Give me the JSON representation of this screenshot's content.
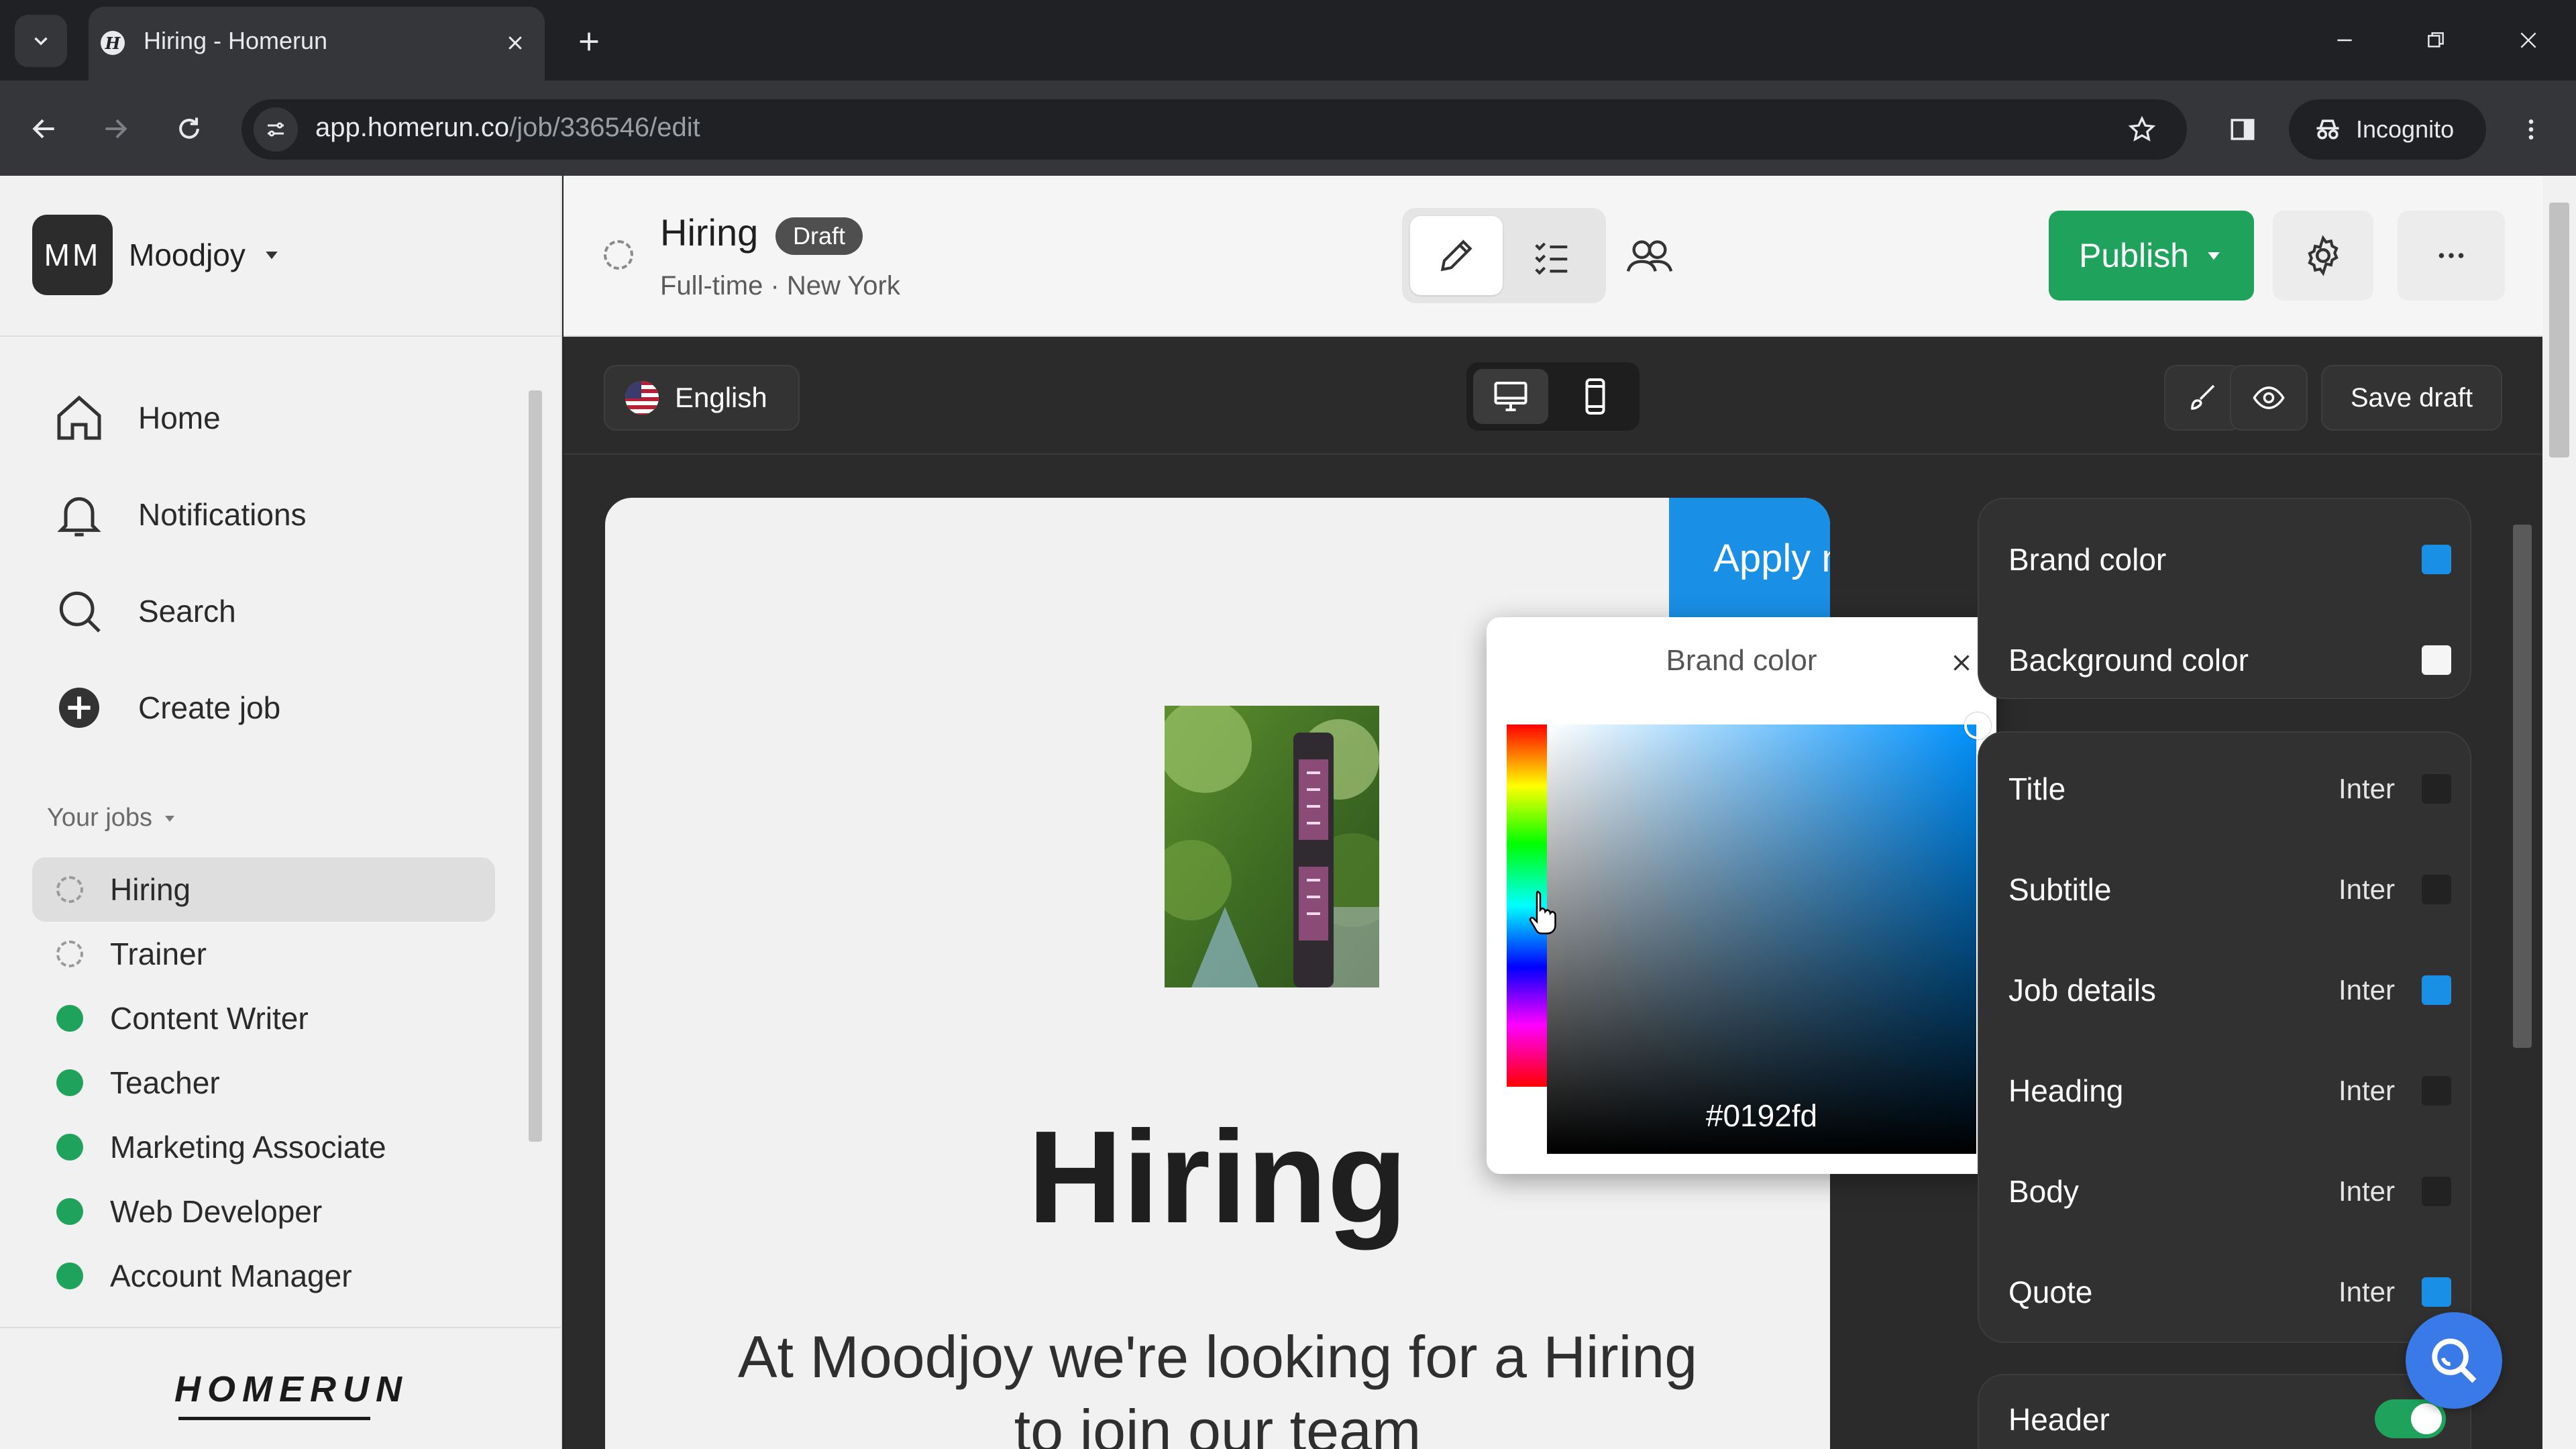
{
  "browser": {
    "tab_title": "Hiring - Homerun",
    "favicon_letter": "H",
    "url_domain": "app.homerun.co",
    "url_path": "/job/336546/edit",
    "incognito_label": "Incognito"
  },
  "sidebar": {
    "org_initials": "MM",
    "org_name": "Moodjoy",
    "nav": [
      {
        "label": "Home",
        "icon": "home-icon"
      },
      {
        "label": "Notifications",
        "icon": "bell-icon"
      },
      {
        "label": "Search",
        "icon": "search-icon"
      },
      {
        "label": "Create job",
        "icon": "plus-circle-icon"
      }
    ],
    "your_jobs_label": "Your jobs",
    "jobs": [
      {
        "label": "Hiring",
        "status": "draft"
      },
      {
        "label": "Trainer",
        "status": "draft"
      },
      {
        "label": "Content Writer",
        "status": "published"
      },
      {
        "label": "Teacher",
        "status": "published"
      },
      {
        "label": "Marketing Associate",
        "status": "published"
      },
      {
        "label": "Web Developer",
        "status": "published"
      },
      {
        "label": "Account Manager",
        "status": "published"
      }
    ],
    "logo_text": "HOMERUN"
  },
  "header": {
    "title": "Hiring",
    "badge": "Draft",
    "meta": "Full-time · New York",
    "publish_label": "Publish"
  },
  "editor": {
    "language": "English",
    "save_draft_label": "Save draft"
  },
  "preview": {
    "apply_label": "Apply now",
    "title": "Hiring",
    "subtitle_line1": "At Moodjoy we're looking for a Hiring",
    "subtitle_line2": "to join our team"
  },
  "color_picker": {
    "title": "Brand color",
    "hex": "#0192fd"
  },
  "settings": {
    "brand_color_label": "Brand color",
    "brand_color": "#1a8fe6",
    "background_color_label": "Background color",
    "background_color": "#f5f5f5",
    "typography": [
      {
        "label": "Title",
        "font": "Inter",
        "color": "#222222"
      },
      {
        "label": "Subtitle",
        "font": "Inter",
        "color": "#222222"
      },
      {
        "label": "Job details",
        "font": "Inter",
        "color": "#1a8fe6"
      },
      {
        "label": "Heading",
        "font": "Inter",
        "color": "#222222"
      },
      {
        "label": "Body",
        "font": "Inter",
        "color": "#222222"
      },
      {
        "label": "Quote",
        "font": "Inter",
        "color": "#1a8fe6"
      }
    ],
    "header_label": "Header",
    "header_enabled": true
  },
  "colors": {
    "publish_green": "#1fa35c",
    "apply_blue": "#1a8fe6"
  }
}
